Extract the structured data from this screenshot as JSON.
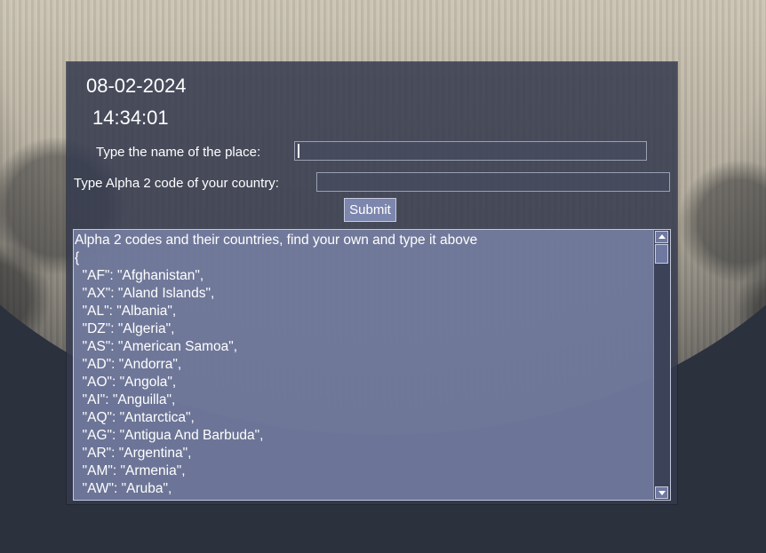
{
  "header": {
    "date": "08-02-2024",
    "time": "14:34:01"
  },
  "form": {
    "place_label": "Type the name of the place:",
    "place_value": "",
    "code_label": "Type Alpha 2 code of your country:",
    "code_value": "",
    "submit_label": "Submit"
  },
  "codes_box": {
    "lines": [
      "Alpha 2 codes and their countries, find your own and type it above",
      "{",
      "  \"AF\": \"Afghanistan\",",
      "  \"AX\": \"Aland Islands\",",
      "  \"AL\": \"Albania\",",
      "  \"DZ\": \"Algeria\",",
      "  \"AS\": \"American Samoa\",",
      "  \"AD\": \"Andorra\",",
      "  \"AO\": \"Angola\",",
      "  \"AI\": \"Anguilla\",",
      "  \"AQ\": \"Antarctica\",",
      "  \"AG\": \"Antigua And Barbuda\",",
      "  \"AR\": \"Argentina\",",
      "  \"AM\": \"Armenia\",",
      "  \"AW\": \"Aruba\","
    ]
  },
  "colors": {
    "page_background": "#2b313d",
    "panel_background": "#343a4e",
    "text_area_background": "#828cb4",
    "button_background": "#7d86ad",
    "text": "#ffffff"
  }
}
